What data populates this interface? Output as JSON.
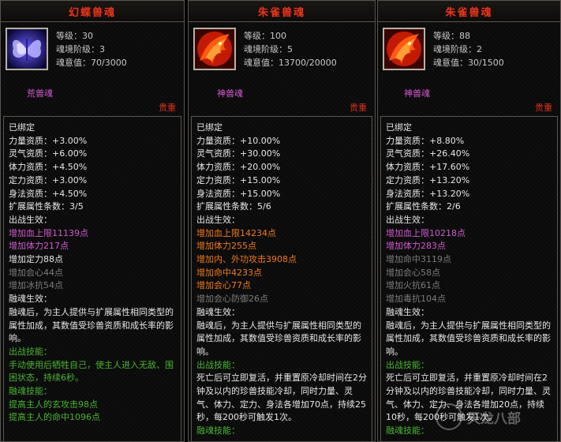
{
  "cards": [
    {
      "title": "幻蝶兽魂",
      "stats": [
        "等级：30",
        "魂境阶级：3",
        "魂意值：70/3000"
      ],
      "type_label": "荒兽魂",
      "rarity": "贵重",
      "icon": "butterfly-icon",
      "lines": [
        {
          "t": "已绑定",
          "c": "white"
        },
        {
          "t": "力量资质：+3.00%",
          "c": "white"
        },
        {
          "t": "灵气资质：+6.00%",
          "c": "white"
        },
        {
          "t": "体力资质：+4.50%",
          "c": "white"
        },
        {
          "t": "定力资质：+3.00%",
          "c": "white"
        },
        {
          "t": "身法资质：+4.50%",
          "c": "white"
        },
        {
          "t": "扩展属性条数：3/5",
          "c": "white"
        },
        {
          "t": "出战生效：",
          "c": "white"
        },
        {
          "t": "增加血上限11139点",
          "c": "purple"
        },
        {
          "t": "增加体力217点",
          "c": "purple"
        },
        {
          "t": "增加定力88点",
          "c": "white"
        },
        {
          "t": "增加会心44点",
          "c": "gray"
        },
        {
          "t": "增加冰抗54点",
          "c": "gray"
        },
        {
          "t": "融魂生效：",
          "c": "white"
        },
        {
          "t": "融魂后，为主人提供与扩展属性相同类型的属性加成，其数值受珍兽资质和成长率的影响。",
          "c": "white",
          "wrap": true
        },
        {
          "t": "出战技能：",
          "c": "green"
        },
        {
          "t": "手动使用后牺牲自己，使主人进入无敌、围困状态，持续6秒。",
          "c": "green",
          "wrap": true
        },
        {
          "t": "融魂技能：",
          "c": "green"
        },
        {
          "t": "提高主人的玄攻击98点",
          "c": "green"
        },
        {
          "t": "提高主人的命中1096点",
          "c": "green"
        }
      ]
    },
    {
      "title": "朱雀兽魂",
      "stats": [
        "等级：100",
        "魂境阶级：5",
        "魂意值：13700/20000"
      ],
      "type_label": "神兽魂",
      "rarity": "贵重",
      "icon": "phoenix-icon",
      "lines": [
        {
          "t": "已绑定",
          "c": "white"
        },
        {
          "t": "力量资质：+10.00%",
          "c": "white"
        },
        {
          "t": "灵气资质：+30.00%",
          "c": "white"
        },
        {
          "t": "体力资质：+20.00%",
          "c": "white"
        },
        {
          "t": "定力资质：+15.00%",
          "c": "white"
        },
        {
          "t": "身法资质：+15.00%",
          "c": "white"
        },
        {
          "t": "扩展属性条数：5/6",
          "c": "white"
        },
        {
          "t": "出战生效：",
          "c": "white"
        },
        {
          "t": "增加血上限14234点",
          "c": "orange"
        },
        {
          "t": "增加体力255点",
          "c": "orange"
        },
        {
          "t": "增加内、外功攻击3908点",
          "c": "orange"
        },
        {
          "t": "增加命中4233点",
          "c": "orange"
        },
        {
          "t": "增加会心77点",
          "c": "orange"
        },
        {
          "t": "增加会心防御26点",
          "c": "gray"
        },
        {
          "t": "融魂生效：",
          "c": "white"
        },
        {
          "t": "融魂后，为主人提供与扩展属性相同类型的属性加成，其数值受珍兽资质和成长率的影响。",
          "c": "white",
          "wrap": true
        },
        {
          "t": "出战技能：",
          "c": "green"
        },
        {
          "t": "死亡后可立即复活，并重置原冷却时间在2分钟及以内的珍兽技能冷却，同时力量、灵气、体力、定力、身法各增加70点，持续25秒，每200秒可触发1次。",
          "c": "white",
          "wrap": true
        },
        {
          "t": "融魂技能：",
          "c": "green"
        }
      ]
    },
    {
      "title": "朱雀兽魂",
      "stats": [
        "等级：88",
        "魂境阶级：2",
        "魂意值：30/1500"
      ],
      "type_label": "神兽魂",
      "rarity": "贵重",
      "icon": "phoenix-icon",
      "lines": [
        {
          "t": "已绑定",
          "c": "white"
        },
        {
          "t": "力量资质：+8.80%",
          "c": "white"
        },
        {
          "t": "灵气资质：+26.40%",
          "c": "white"
        },
        {
          "t": "体力资质：+17.60%",
          "c": "white"
        },
        {
          "t": "定力资质：+13.20%",
          "c": "white"
        },
        {
          "t": "身法资质：+13.20%",
          "c": "white"
        },
        {
          "t": "扩展属性条数：2/6",
          "c": "white"
        },
        {
          "t": "出战生效：",
          "c": "white"
        },
        {
          "t": "增加血上限10218点",
          "c": "purple"
        },
        {
          "t": "增加体力283点",
          "c": "purple"
        },
        {
          "t": "增加命中3119点",
          "c": "gray"
        },
        {
          "t": "增加会心58点",
          "c": "gray"
        },
        {
          "t": "增加火抗61点",
          "c": "gray"
        },
        {
          "t": "增加毒抗104点",
          "c": "gray"
        },
        {
          "t": "融魂生效：",
          "c": "white"
        },
        {
          "t": "融魂后，为主人提供与扩展属性相同类型的属性加成，其数值受珍兽资质和成长率的影响。",
          "c": "white",
          "wrap": true
        },
        {
          "t": "出战技能：",
          "c": "green"
        },
        {
          "t": "死亡后可立即复活，并重置原冷却时间在2分钟及以内的珍兽技能冷却，同时力量、灵气、体力、定力、身法各增加20点，持续10秒，每200秒可触发1次。",
          "c": "white",
          "wrap": true
        },
        {
          "t": "融魂技能：",
          "c": "green"
        }
      ]
    }
  ],
  "watermark": "天龙八部"
}
